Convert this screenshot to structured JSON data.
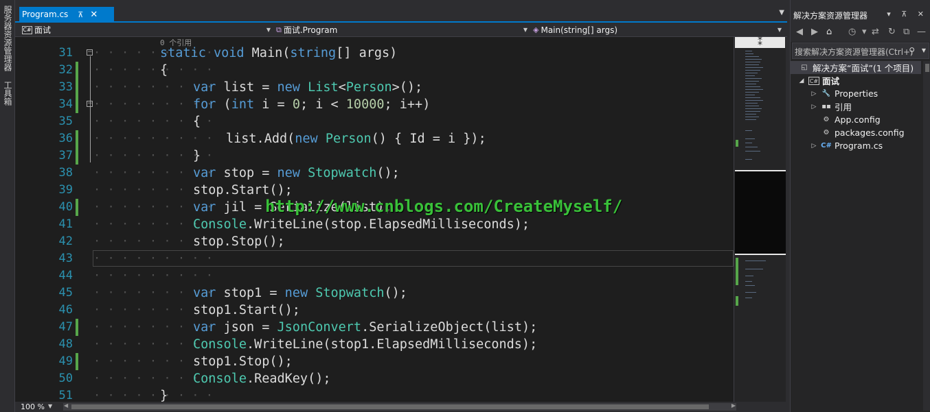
{
  "left_strip": {
    "tabs": [
      "服务器资源管理器",
      "工具箱"
    ]
  },
  "document_tab": {
    "label": "Program.cs",
    "pin": "⊼",
    "close": "✕"
  },
  "nav_bar": {
    "project": "面试",
    "class": "面试.Program",
    "member": "Main(string[] args)"
  },
  "editor": {
    "codelens": "0 个引用",
    "watermark": "http://www.cnblogs.com/CreateMyself/",
    "lines": [
      {
        "num": "31",
        "segments": [
          [
            "kw",
            "static"
          ],
          [
            "",
            " "
          ],
          [
            "kw",
            "void"
          ],
          [
            "",
            " Main("
          ],
          [
            "kw",
            "string"
          ],
          [
            "",
            "[] args)"
          ]
        ],
        "indent": 0,
        "changed": false,
        "fold": "−"
      },
      {
        "num": "32",
        "segments": [
          [
            "",
            "{"
          ]
        ],
        "indent": 0,
        "changed": true,
        "fold": ""
      },
      {
        "num": "33",
        "segments": [
          [
            "kw",
            "var"
          ],
          [
            "",
            " list = "
          ],
          [
            "kw",
            "new"
          ],
          [
            "",
            " "
          ],
          [
            "ty",
            "List"
          ],
          [
            "",
            "<"
          ],
          [
            "ty",
            "Person"
          ],
          [
            "",
            ">();"
          ]
        ],
        "indent": 1,
        "changed": true,
        "fold": ""
      },
      {
        "num": "34",
        "segments": [
          [
            "kw",
            "for"
          ],
          [
            "",
            " ("
          ],
          [
            "kw",
            "int"
          ],
          [
            "",
            " i = "
          ],
          [
            "num",
            "0"
          ],
          [
            "",
            "; i < "
          ],
          [
            "num",
            "10000"
          ],
          [
            "",
            "; i++)"
          ]
        ],
        "indent": 1,
        "changed": true,
        "fold": "−"
      },
      {
        "num": "35",
        "segments": [
          [
            "",
            "{"
          ]
        ],
        "indent": 1,
        "changed": false,
        "fold": ""
      },
      {
        "num": "36",
        "segments": [
          [
            "",
            "list.Add("
          ],
          [
            "kw",
            "new"
          ],
          [
            "",
            " "
          ],
          [
            "ty",
            "Person"
          ],
          [
            "",
            "() { Id = i });"
          ]
        ],
        "indent": 2,
        "changed": true,
        "fold": ""
      },
      {
        "num": "37",
        "segments": [
          [
            "",
            "}"
          ]
        ],
        "indent": 1,
        "changed": true,
        "fold": ""
      },
      {
        "num": "38",
        "segments": [
          [
            "kw",
            "var"
          ],
          [
            "",
            " stop = "
          ],
          [
            "kw",
            "new"
          ],
          [
            "",
            " "
          ],
          [
            "ty",
            "Stopwatch"
          ],
          [
            "",
            "();"
          ]
        ],
        "indent": 1,
        "changed": false,
        "fold": ""
      },
      {
        "num": "39",
        "segments": [
          [
            "",
            "stop.Start();"
          ]
        ],
        "indent": 1,
        "changed": false,
        "fold": ""
      },
      {
        "num": "40",
        "segments": [
          [
            "kw",
            "var"
          ],
          [
            "",
            " jil = Serialize(list);"
          ]
        ],
        "indent": 1,
        "changed": true,
        "fold": ""
      },
      {
        "num": "41",
        "segments": [
          [
            "ty",
            "Console"
          ],
          [
            "",
            ".WriteLine(stop.ElapsedMilliseconds);"
          ]
        ],
        "indent": 1,
        "changed": false,
        "fold": ""
      },
      {
        "num": "42",
        "segments": [
          [
            "",
            "stop.Stop();"
          ]
        ],
        "indent": 1,
        "changed": false,
        "fold": ""
      },
      {
        "num": "43",
        "segments": [],
        "indent": 1,
        "changed": false,
        "fold": ""
      },
      {
        "num": "44",
        "segments": [],
        "indent": 1,
        "changed": false,
        "fold": ""
      },
      {
        "num": "45",
        "segments": [
          [
            "kw",
            "var"
          ],
          [
            "",
            " stop1 = "
          ],
          [
            "kw",
            "new"
          ],
          [
            "",
            " "
          ],
          [
            "ty",
            "Stopwatch"
          ],
          [
            "",
            "();"
          ]
        ],
        "indent": 1,
        "changed": false,
        "fold": ""
      },
      {
        "num": "46",
        "segments": [
          [
            "",
            "stop1.Start();"
          ]
        ],
        "indent": 1,
        "changed": false,
        "fold": ""
      },
      {
        "num": "47",
        "segments": [
          [
            "kw",
            "var"
          ],
          [
            "",
            " json = "
          ],
          [
            "ty",
            "JsonConvert"
          ],
          [
            "",
            ".SerializeObject(list);"
          ]
        ],
        "indent": 1,
        "changed": true,
        "fold": ""
      },
      {
        "num": "48",
        "segments": [
          [
            "ty",
            "Console"
          ],
          [
            "",
            ".WriteLine(stop1.ElapsedMilliseconds);"
          ]
        ],
        "indent": 1,
        "changed": false,
        "fold": ""
      },
      {
        "num": "49",
        "segments": [
          [
            "",
            "stop1.Stop();"
          ]
        ],
        "indent": 1,
        "changed": true,
        "fold": ""
      },
      {
        "num": "50",
        "segments": [
          [
            "ty",
            "Console"
          ],
          [
            "",
            ".ReadKey();"
          ]
        ],
        "indent": 1,
        "changed": false,
        "fold": ""
      },
      {
        "num": "51",
        "segments": [
          [
            "",
            "}"
          ]
        ],
        "indent": 0,
        "changed": false,
        "fold": ""
      }
    ]
  },
  "bottom_bar": {
    "zoom": "100 %"
  },
  "solution_explorer": {
    "title": "解决方案资源管理器",
    "title_buttons": "▾ ⊼ ✕",
    "search_placeholder": "搜索解决方案资源管理器(Ctrl+;)",
    "tree": [
      {
        "label": "解决方案“面试”(1 个项目)",
        "level": 0,
        "twisty": "",
        "icon": "solution-icon",
        "glyph": "◱",
        "selected": true
      },
      {
        "label": "面试",
        "level": 1,
        "twisty": "◢",
        "icon": "csharp-project-icon",
        "glyph": "C#",
        "selected": false,
        "bold": true
      },
      {
        "label": "Properties",
        "level": 2,
        "twisty": "▷",
        "icon": "wrench-icon",
        "glyph": "🔧",
        "selected": false
      },
      {
        "label": "引用",
        "level": 2,
        "twisty": "▷",
        "icon": "references-icon",
        "glyph": "▪▪",
        "selected": false
      },
      {
        "label": "App.config",
        "level": 2,
        "twisty": "",
        "icon": "config-file-icon",
        "glyph": "⚙",
        "selected": false
      },
      {
        "label": "packages.config",
        "level": 2,
        "twisty": "",
        "icon": "config-file-icon",
        "glyph": "⚙",
        "selected": false
      },
      {
        "label": "Program.cs",
        "level": 2,
        "twisty": "▷",
        "icon": "csharp-file-icon",
        "glyph": "C#",
        "selected": false
      }
    ]
  },
  "colors": {
    "keyword": "#569cd6",
    "type": "#4ec9b0",
    "number": "#b5cea8",
    "line_number": "#2b91af",
    "accent": "#007acc",
    "change_marker": "#57a64a"
  }
}
